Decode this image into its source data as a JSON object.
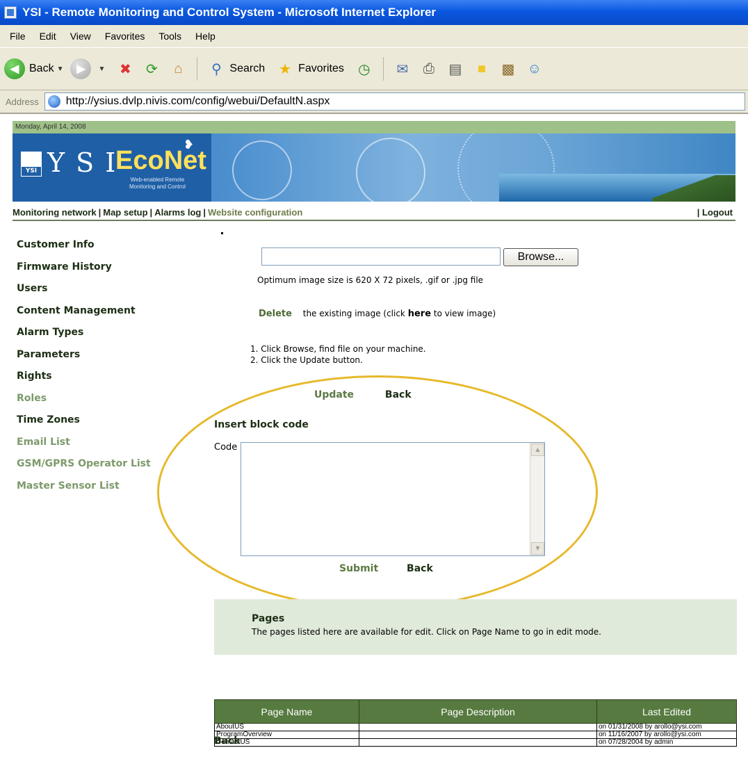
{
  "window": {
    "title": "YSI - Remote Monitoring and Control System - Microsoft Internet Explorer"
  },
  "menu": [
    "File",
    "Edit",
    "View",
    "Favorites",
    "Tools",
    "Help"
  ],
  "toolbar": {
    "back_label": "Back",
    "search_label": "Search",
    "favorites_label": "Favorites"
  },
  "address": {
    "label": "Address",
    "url": "http://ysius.dvlp.nivis.com/config/webui/DefaultN.aspx"
  },
  "header": {
    "date": "Monday, April 14, 2008",
    "logo_main": "Y S I",
    "logo_brand": "EcoNet",
    "logo_tagline_1": "Web-enabled Remote",
    "logo_tagline_2": "Monitoring and Control"
  },
  "nav": {
    "monitoring": "Monitoring network",
    "map_setup": "Map setup",
    "alarms_log": "Alarms log",
    "website_config": "Website configuration",
    "separator": "|",
    "logout": "| Logout"
  },
  "sidebar": {
    "items": [
      {
        "label": "Customer Info",
        "muted": false
      },
      {
        "label": "Firmware History",
        "muted": false
      },
      {
        "label": "Users",
        "muted": false
      },
      {
        "label": "Content Management",
        "muted": false
      },
      {
        "label": "Alarm Types",
        "muted": false
      },
      {
        "label": "Parameters",
        "muted": false
      },
      {
        "label": "Rights",
        "muted": false
      },
      {
        "label": "Roles",
        "muted": true
      },
      {
        "label": "Time Zones",
        "muted": false
      },
      {
        "label": "Email List",
        "muted": true
      },
      {
        "label": "GSM/GPRS Operator List",
        "muted": true
      },
      {
        "label": "Master Sensor List",
        "muted": true
      }
    ]
  },
  "upload": {
    "browse_label": "Browse...",
    "hint": "Optimum image size is 620 X 72 pixels, .gif or .jpg file",
    "delete_label": "Delete",
    "delete_text_before": "the existing image (click",
    "here_label": "here",
    "delete_text_after": "to view image)",
    "step1": "1. Click Browse, find file on your machine.",
    "step2": "2. Click the Update button.",
    "update_label": "Update",
    "back_label": "Back"
  },
  "block_code": {
    "title": "Insert block code",
    "code_label": "Code",
    "submit_label": "Submit",
    "back_label": "Back"
  },
  "pages": {
    "title": "Pages",
    "description": "The pages listed here are available for edit. Click on Page Name to go in edit mode.",
    "columns": [
      "Page Name",
      "Page Description",
      "Last Edited"
    ],
    "rows": [
      {
        "name": "AboutUS",
        "description": "",
        "edited": "on 01/31/2008 by arollo@ysi.com"
      },
      {
        "name": "ProgramOverview",
        "description": "",
        "edited": "on 11/16/2007 by arollo@ysi.com"
      },
      {
        "name": "ContactUS",
        "description": "",
        "edited": "on 07/28/2004 by admin"
      }
    ],
    "back_label": "Back"
  },
  "colors": {
    "accent_green": "#567a3f",
    "highlight": "#e6b92b",
    "title_blue": "#0a58e0"
  }
}
